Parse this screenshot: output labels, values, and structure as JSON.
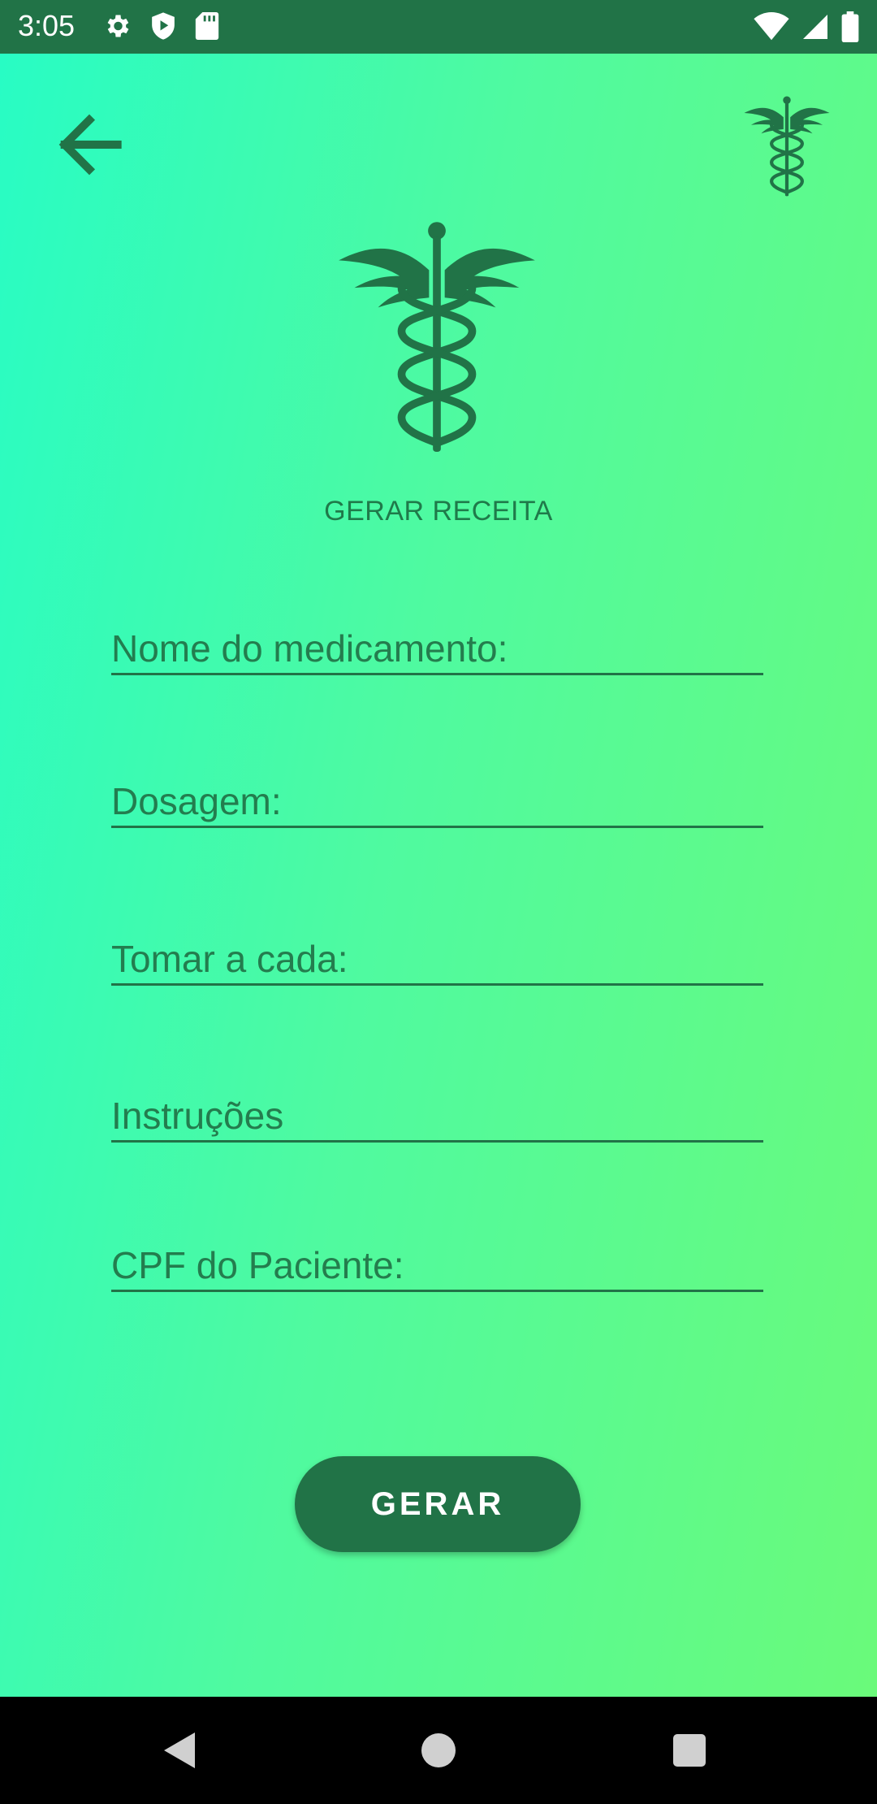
{
  "status_bar": {
    "time": "3:05",
    "left_icons": [
      "gear-icon",
      "shield-play-icon",
      "sd-card-icon"
    ],
    "right_icons": [
      "wifi-icon",
      "signal-icon",
      "battery-icon"
    ]
  },
  "colors": {
    "primary": "#217347",
    "gradient_start": "#28fcc4",
    "gradient_end": "#6afa7a",
    "nav_bar": "#000000"
  },
  "header": {
    "back_icon": "arrow-left-icon",
    "logo_icon": "caduceus-icon"
  },
  "page": {
    "title": "GERAR RECEITA"
  },
  "form": {
    "fields": [
      {
        "placeholder": "Nome do medicamento:",
        "value": ""
      },
      {
        "placeholder": "Dosagem:",
        "value": ""
      },
      {
        "placeholder": "Tomar a cada:",
        "value": ""
      },
      {
        "placeholder": "Instruções",
        "value": ""
      },
      {
        "placeholder": "CPF do Paciente:",
        "value": ""
      }
    ],
    "submit_label": "GERAR"
  },
  "nav_bar": {
    "icons": [
      "triangle-back-icon",
      "circle-home-icon",
      "square-recents-icon"
    ]
  }
}
